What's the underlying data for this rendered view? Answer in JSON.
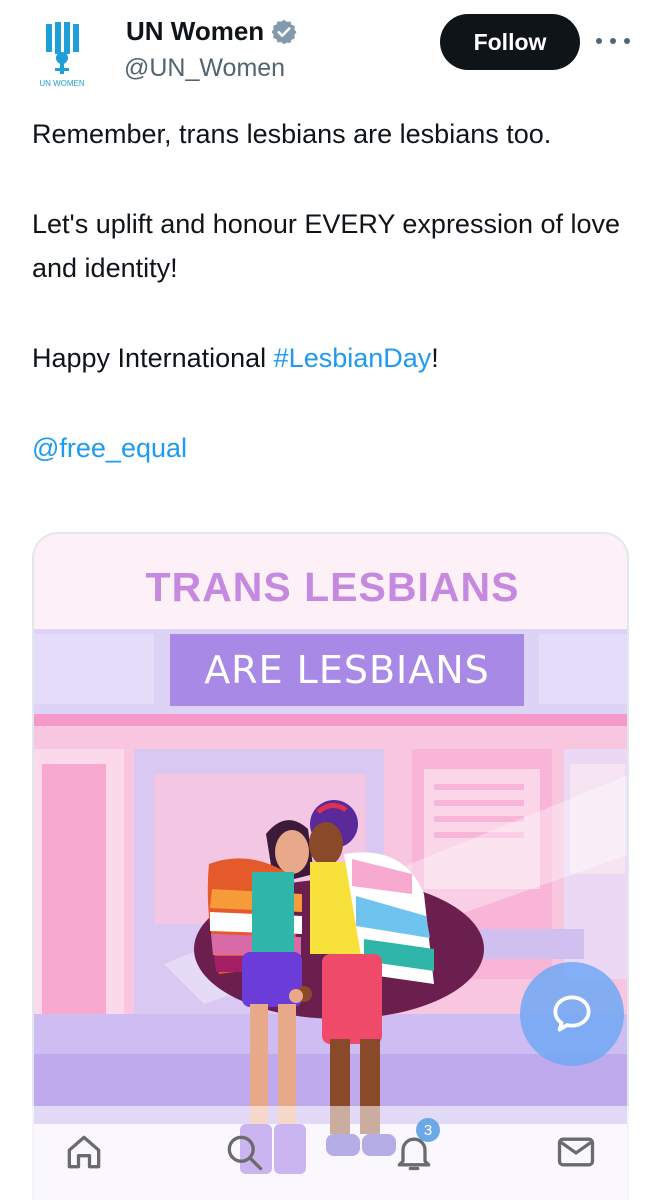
{
  "author": {
    "name": "UN Women",
    "handle": "@UN_Women",
    "avatar_caption": "UN WOMEN",
    "verified": true
  },
  "actions": {
    "follow_label": "Follow",
    "more_icon": "more-horizontal-icon"
  },
  "tweet": {
    "paragraph1": "Remember, trans lesbians are lesbians too.",
    "paragraph2": "Let's uplift and honour EVERY expression of love and identity!",
    "paragraph3_prefix": "Happy International ",
    "hashtag": "#LesbianDay",
    "paragraph3_suffix": "!",
    "mention": "@free_equal"
  },
  "media": {
    "headline1": "TRANS LESBIANS",
    "headline2": "ARE LESBIANS"
  },
  "nav": {
    "items": [
      "home-icon",
      "search-icon",
      "notifications-icon",
      "messages-icon"
    ],
    "notification_count": "3"
  },
  "colors": {
    "follow_bg": "#0f1419",
    "link": "#1d9bf0",
    "verified": "#829aab",
    "headline1": "#c58ae0",
    "headline2_box": "#a88ae6",
    "fab": "#70a8f5"
  }
}
